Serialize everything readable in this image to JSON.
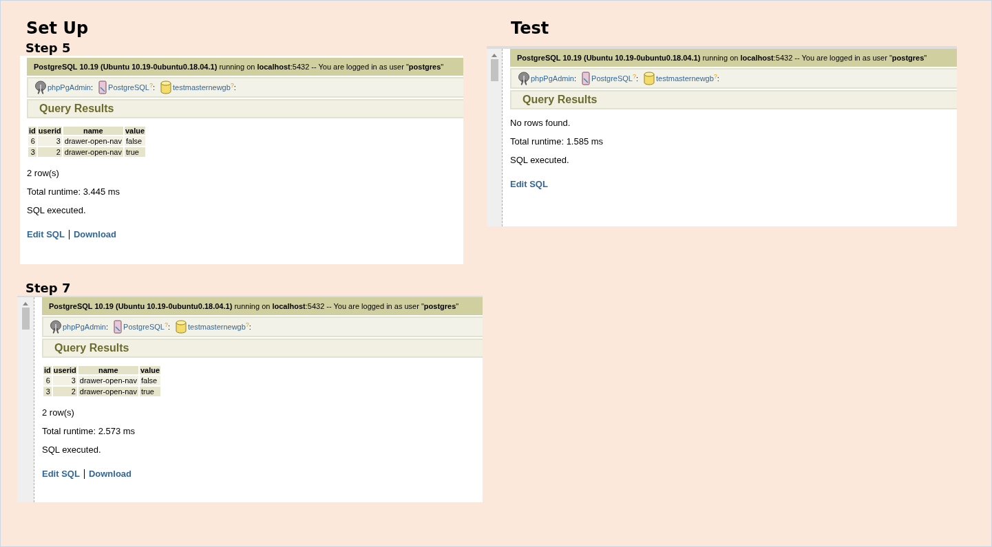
{
  "columns": [
    {
      "heading": "Set Up",
      "panels": [
        {
          "step": "Step 5",
          "scrollbar": false,
          "server_info": "**PostgreSQL 10.19 (Ubuntu 10.19-0ubuntu0.18.04.1)** running on **localhost**:5432 -- You are logged in as user \"**postgres**\"",
          "breadcrumb": [
            {
              "kind": "app",
              "label": "phpPgAdmin",
              "separator": ":"
            },
            {
              "kind": "server",
              "label": "PostgreSQL",
              "help": "?",
              "separator": ":"
            },
            {
              "kind": "database",
              "label": "testmasternewgb",
              "help": "?",
              "separator": ":"
            }
          ],
          "section_title": "Query Results",
          "table": {
            "columns": [
              "id",
              "userid",
              "name",
              "value"
            ],
            "rows": [
              [
                "6",
                "3",
                "drawer-open-nav",
                "false"
              ],
              [
                "3",
                "2",
                "drawer-open-nav",
                "true"
              ]
            ]
          },
          "messages": [
            "2 row(s)",
            "Total runtime: 3.445 ms",
            "SQL executed."
          ],
          "links": [
            "Edit SQL",
            "Download"
          ]
        },
        {
          "step": "Step 7",
          "scrollbar": true,
          "server_info": "**PostgreSQL 10.19 (Ubuntu 10.19-0ubuntu0.18.04.1)** running on **localhost**:5432 -- You are logged in as user \"**postgres**\"",
          "breadcrumb": [
            {
              "kind": "app",
              "label": "phpPgAdmin",
              "separator": ":"
            },
            {
              "kind": "server",
              "label": "PostgreSQL",
              "help": "?",
              "separator": ":"
            },
            {
              "kind": "database",
              "label": "testmasternewgb",
              "help": "?",
              "separator": ":"
            }
          ],
          "section_title": "Query Results",
          "table": {
            "columns": [
              "id",
              "userid",
              "name",
              "value"
            ],
            "rows": [
              [
                "6",
                "3",
                "drawer-open-nav",
                "false"
              ],
              [
                "3",
                "2",
                "drawer-open-nav",
                "true"
              ]
            ]
          },
          "messages": [
            "2 row(s)",
            "Total runtime: 2.573 ms",
            "SQL executed."
          ],
          "links": [
            "Edit SQL",
            "Download"
          ]
        }
      ]
    },
    {
      "heading": "Test",
      "panels": [
        {
          "scrollbar": true,
          "server_info": "**PostgreSQL 10.19 (Ubuntu 10.19-0ubuntu0.18.04.1)** running on **localhost**:5432 -- You are logged in as user \"**postgres**\"",
          "breadcrumb": [
            {
              "kind": "app",
              "label": "phpPgAdmin",
              "separator": ":"
            },
            {
              "kind": "server",
              "label": "PostgreSQL",
              "help": "?",
              "separator": ":"
            },
            {
              "kind": "database",
              "label": "testmasternewgb",
              "help": "?",
              "separator": ":"
            }
          ],
          "section_title": "Query Results",
          "messages": [
            "No rows found.",
            "Total runtime: 1.585 ms",
            "SQL executed."
          ],
          "links": [
            "Edit SQL"
          ]
        }
      ]
    }
  ]
}
